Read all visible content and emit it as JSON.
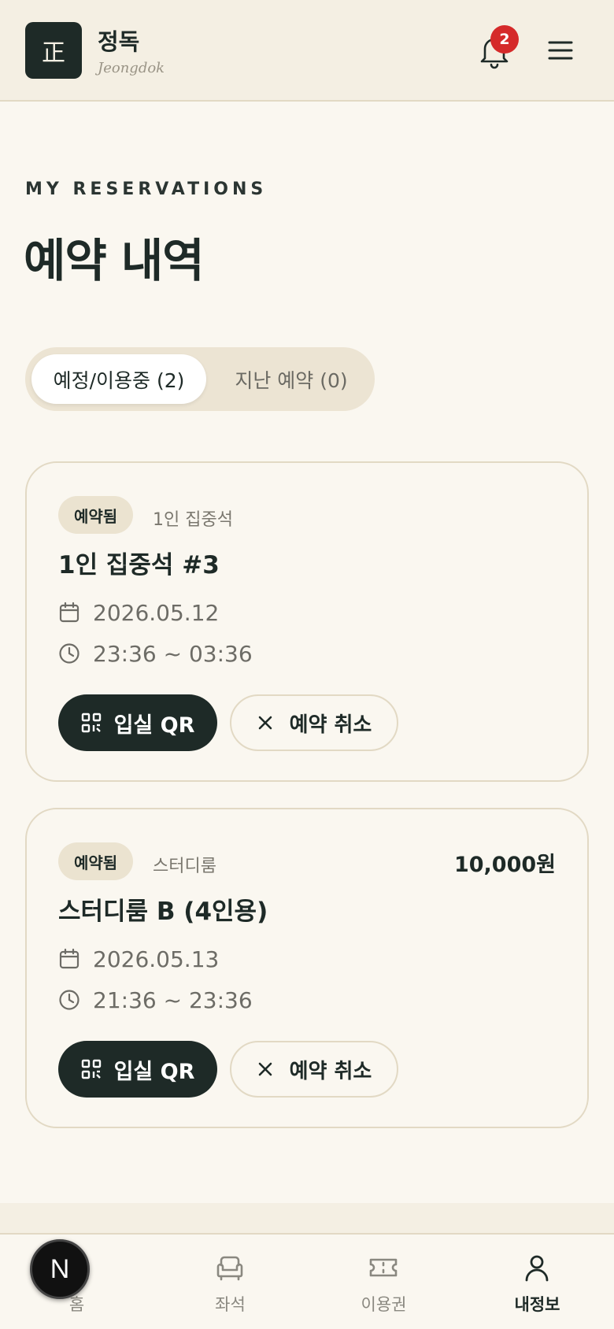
{
  "header": {
    "logo_char": "正",
    "brand_name": "정독",
    "brand_sub": "Jeongdok",
    "notification_count": "2"
  },
  "page": {
    "eyebrow": "MY RESERVATIONS",
    "title": "예약 내역"
  },
  "tabs": [
    {
      "label": "예정/이용중 (2)",
      "active": true
    },
    {
      "label": "지난 예약 (0)",
      "active": false
    }
  ],
  "reservations": [
    {
      "status": "예약됨",
      "seat_type": "1인 집중석",
      "title": "1인 집중석 #3",
      "price": "",
      "date": "2026.05.12",
      "time": "23:36 ~ 03:36",
      "qr_label": "입실 QR",
      "cancel_label": "예약 취소"
    },
    {
      "status": "예약됨",
      "seat_type": "스터디룸",
      "title": "스터디룸 B (4인용)",
      "price": "10,000원",
      "date": "2026.05.13",
      "time": "21:36 ~ 23:36",
      "qr_label": "입실 QR",
      "cancel_label": "예약 취소"
    }
  ],
  "bottom_nav": [
    {
      "label": "홈",
      "icon": "home-icon",
      "active": false
    },
    {
      "label": "좌석",
      "icon": "armchair-icon",
      "active": false
    },
    {
      "label": "이용권",
      "icon": "ticket-icon",
      "active": false
    },
    {
      "label": "내정보",
      "icon": "user-icon",
      "active": true
    }
  ],
  "dev_badge": "N",
  "colors": {
    "primary": "#1e2a27",
    "background": "#faf7f0",
    "header_bg": "#f4efe3",
    "border": "#e2d9c4",
    "pill_bg": "#ebe3d0",
    "badge_red": "#d52a2a"
  }
}
